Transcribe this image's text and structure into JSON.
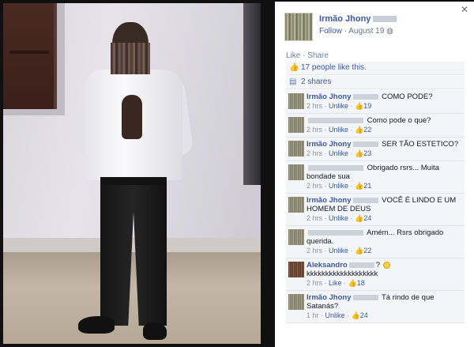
{
  "post": {
    "author": "Irmão Jhony",
    "follow_label": "Follow",
    "date": "August 19",
    "like_action": "Like",
    "share_action": "Share",
    "likes_text": "17 people like this.",
    "shares_text": "2 shares"
  },
  "icons": {
    "close": "close-icon",
    "like": "thumbs-up-icon",
    "share": "share-icon",
    "privacy": "globe-icon"
  },
  "comments": [
    {
      "author": "Irmão Jhony",
      "text": "COMO PODE?",
      "time": "2 hrs",
      "action": "Unlike",
      "likes": "19"
    },
    {
      "author": "",
      "text": "Como pode o que?",
      "time": "2 hrs",
      "action": "Unlike",
      "likes": "22"
    },
    {
      "author": "Irmão Jhony",
      "text": "SER TÃO ESTETICO?",
      "time": "2 hrs",
      "action": "Unlike",
      "likes": "23"
    },
    {
      "author": "",
      "text": "Obrigado rsrs... Muita bondade sua",
      "time": "2 hrs",
      "action": "Unlike",
      "likes": "21"
    },
    {
      "author": "Irmão Jhony",
      "text": "VOCÊ É LINDO E UM HOMEM DE DEUS",
      "time": "2 hrs",
      "action": "Unlike",
      "likes": "24"
    },
    {
      "author": "",
      "text": "Amém... Rsrs obrigado querida.",
      "time": "2 hrs",
      "action": "Unlike",
      "likes": "22"
    },
    {
      "author": "Aleksandro",
      "text_pre": "?",
      "text": "kkkkkkkkkkkkkkkkkkk",
      "time": "2 hrs",
      "action": "Like",
      "likes": "18"
    },
    {
      "author": "Irmão Jhony",
      "text": "Tá rindo de que Satanás?",
      "time": "1 hr",
      "action": "Unlike",
      "likes": "24"
    }
  ],
  "colors": {
    "link": "#3b5998",
    "comment_bg": "#f4f5f8",
    "meta": "#8c93a2"
  }
}
